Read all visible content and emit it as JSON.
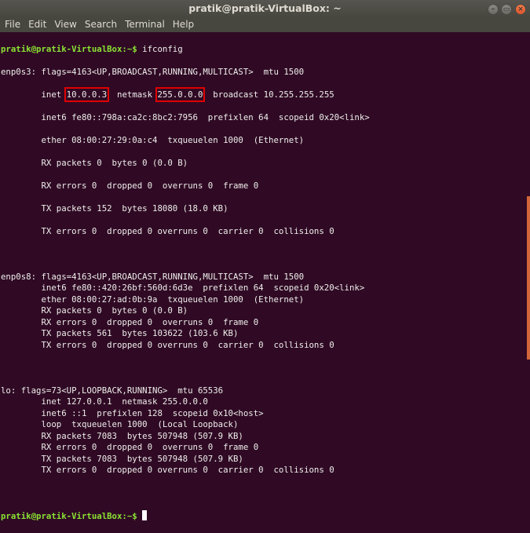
{
  "window": {
    "title": "pratik@pratik-VirtualBox: ~"
  },
  "menu": [
    "File",
    "Edit",
    "View",
    "Search",
    "Terminal",
    "Help"
  ],
  "colors": {
    "background": "#300a24",
    "prompt": "#8ae234",
    "highlight": "#e00000",
    "scrollbar": "#d2653a"
  },
  "terminal": {
    "prompt": "pratik@pratik-VirtualBox:~$",
    "command": " ifconfig",
    "enp0s3": {
      "l0": "enp0s3: flags=4163<UP,BROADCAST,RUNNING,MULTICAST>  mtu 1500",
      "inet_pre": "        inet ",
      "inet_addr": "10.0.0.3",
      "inet_mid": "  netmask ",
      "netmask": "255.0.0.0",
      "inet_post": "  broadcast 10.255.255.255",
      "l2": "        inet6 fe80::798a:ca2c:8bc2:7956  prefixlen 64  scopeid 0x20<link>",
      "l3": "        ether 08:00:27:29:0a:c4  txqueuelen 1000  (Ethernet)",
      "l4": "        RX packets 0  bytes 0 (0.0 B)",
      "l5": "        RX errors 0  dropped 0  overruns 0  frame 0",
      "l6": "        TX packets 152  bytes 18080 (18.0 KB)",
      "l7": "        TX errors 0  dropped 0 overruns 0  carrier 0  collisions 0"
    },
    "enp0s8": [
      "enp0s8: flags=4163<UP,BROADCAST,RUNNING,MULTICAST>  mtu 1500",
      "        inet6 fe80::420:26bf:560d:6d3e  prefixlen 64  scopeid 0x20<link>",
      "        ether 08:00:27:ad:0b:9a  txqueuelen 1000  (Ethernet)",
      "        RX packets 0  bytes 0 (0.0 B)",
      "        RX errors 0  dropped 0  overruns 0  frame 0",
      "        TX packets 561  bytes 103622 (103.6 KB)",
      "        TX errors 0  dropped 0 overruns 0  carrier 0  collisions 0"
    ],
    "lo": [
      "lo: flags=73<UP,LOOPBACK,RUNNING>  mtu 65536",
      "        inet 127.0.0.1  netmask 255.0.0.0",
      "        inet6 ::1  prefixlen 128  scopeid 0x10<host>",
      "        loop  txqueuelen 1000  (Local Loopback)",
      "        RX packets 7083  bytes 507948 (507.9 KB)",
      "        RX errors 0  dropped 0  overruns 0  frame 0",
      "        TX packets 7083  bytes 507948 (507.9 KB)",
      "        TX errors 0  dropped 0 overruns 0  carrier 0  collisions 0"
    ]
  }
}
